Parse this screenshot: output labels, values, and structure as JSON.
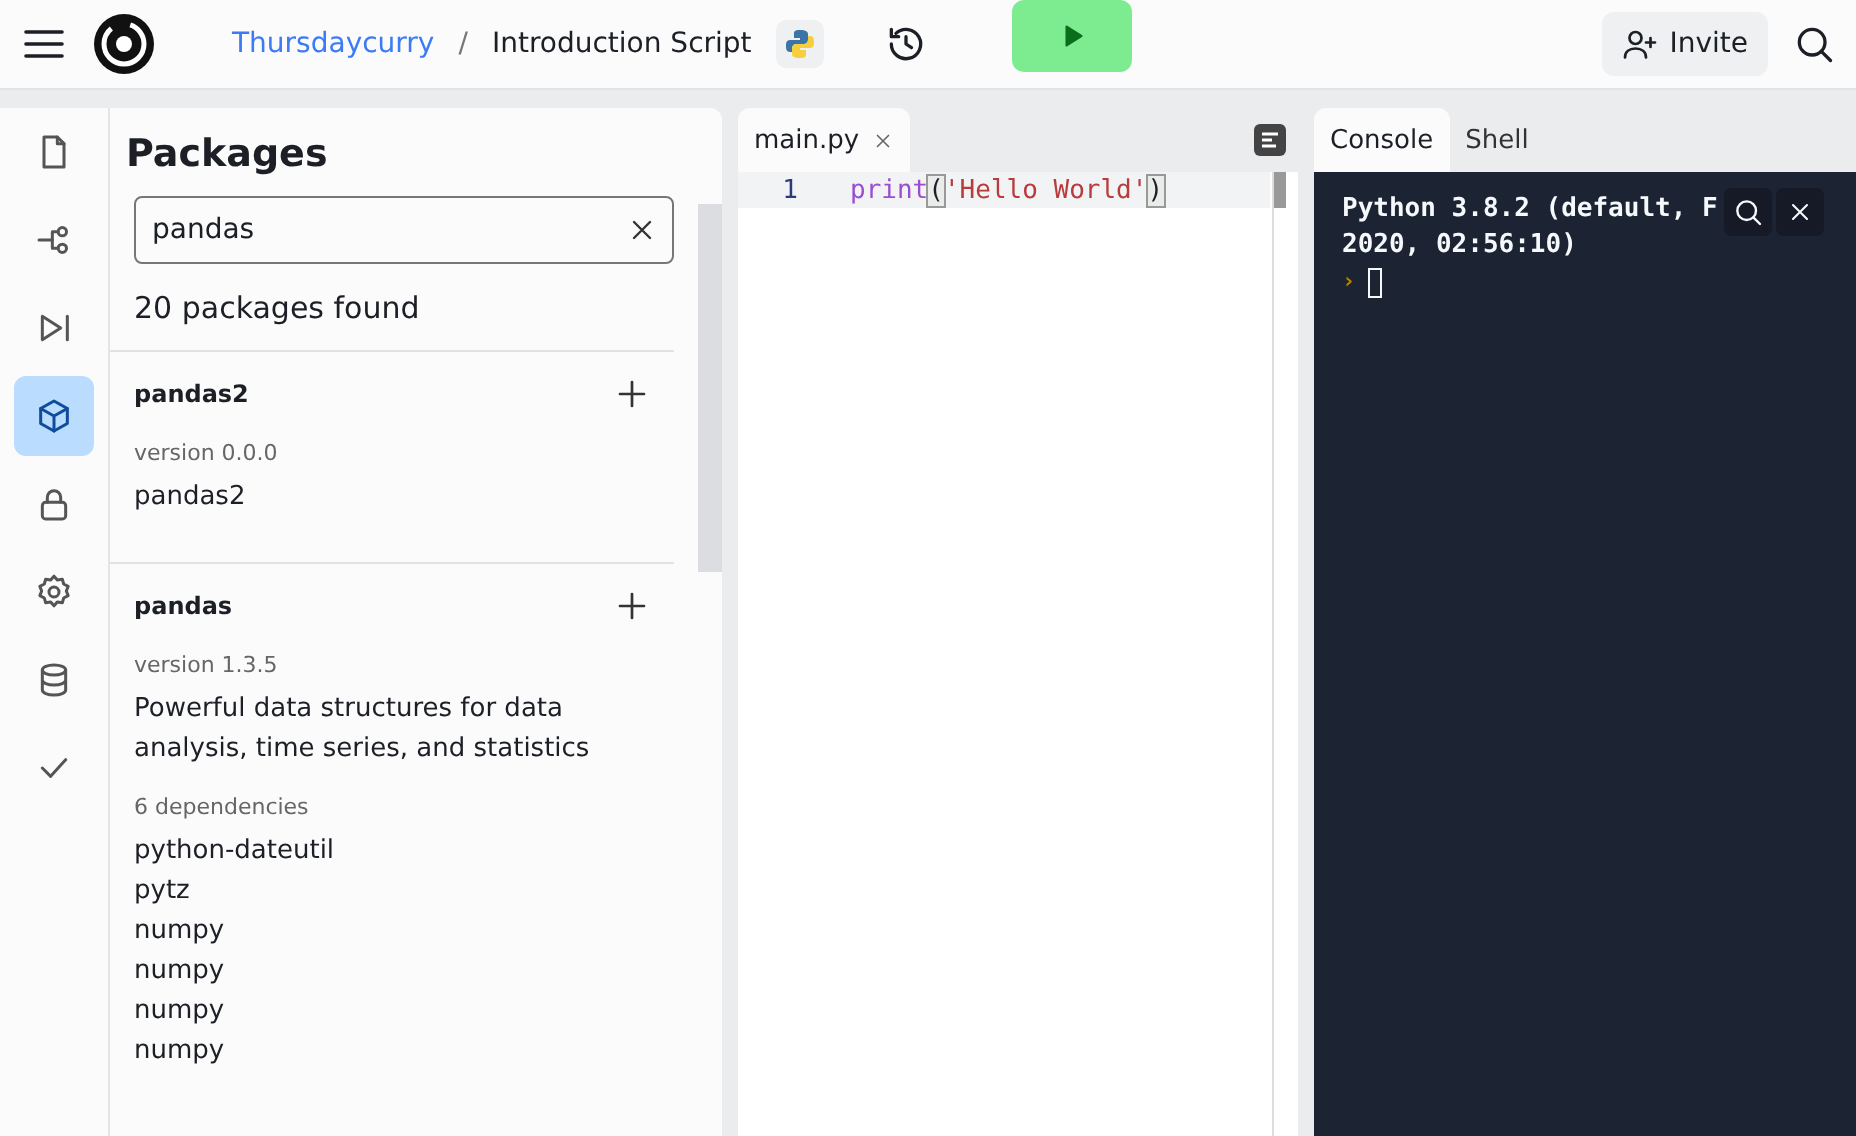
{
  "header": {
    "owner": "Thursdaycurry",
    "separator": "/",
    "title": "Introduction Script",
    "invite": "Invite"
  },
  "sidebar": {
    "items": [
      {
        "kind": "file",
        "selected": false
      },
      {
        "kind": "git",
        "selected": false
      },
      {
        "kind": "debug",
        "selected": false
      },
      {
        "kind": "package",
        "selected": true
      },
      {
        "kind": "lock",
        "selected": false
      },
      {
        "kind": "settings",
        "selected": false
      },
      {
        "kind": "database",
        "selected": false
      },
      {
        "kind": "check",
        "selected": false
      }
    ]
  },
  "packages": {
    "title": "Packages",
    "search": {
      "value": "pandas"
    },
    "count": "20 packages found",
    "results": [
      {
        "name": "pandas2",
        "version": "version 0.0.0",
        "description": "pandas2"
      },
      {
        "name": "pandas",
        "version": "version 1.3.5",
        "description": "Powerful data structures for data analysis, time series, and statistics",
        "dependencies_label": "6 dependencies",
        "dependencies": [
          "python-dateutil",
          "pytz",
          "numpy",
          "numpy",
          "numpy",
          "numpy"
        ]
      }
    ]
  },
  "editor": {
    "tab": "main.py",
    "lines": [
      {
        "number": "1",
        "code": [
          {
            "kind": "keyword",
            "text": "print"
          },
          {
            "kind": "bracket",
            "text": "("
          },
          {
            "kind": "string",
            "text": "'Hello World'"
          },
          {
            "kind": "bracket",
            "text": ")"
          }
        ]
      }
    ]
  },
  "console": {
    "tabs": [
      {
        "label": "Console",
        "selected": true
      },
      {
        "label": "Shell",
        "selected": false
      }
    ],
    "output": [
      "Python 3.8.2 (default, F",
      "2020, 02:56:10)"
    ],
    "prompt": "›"
  }
}
